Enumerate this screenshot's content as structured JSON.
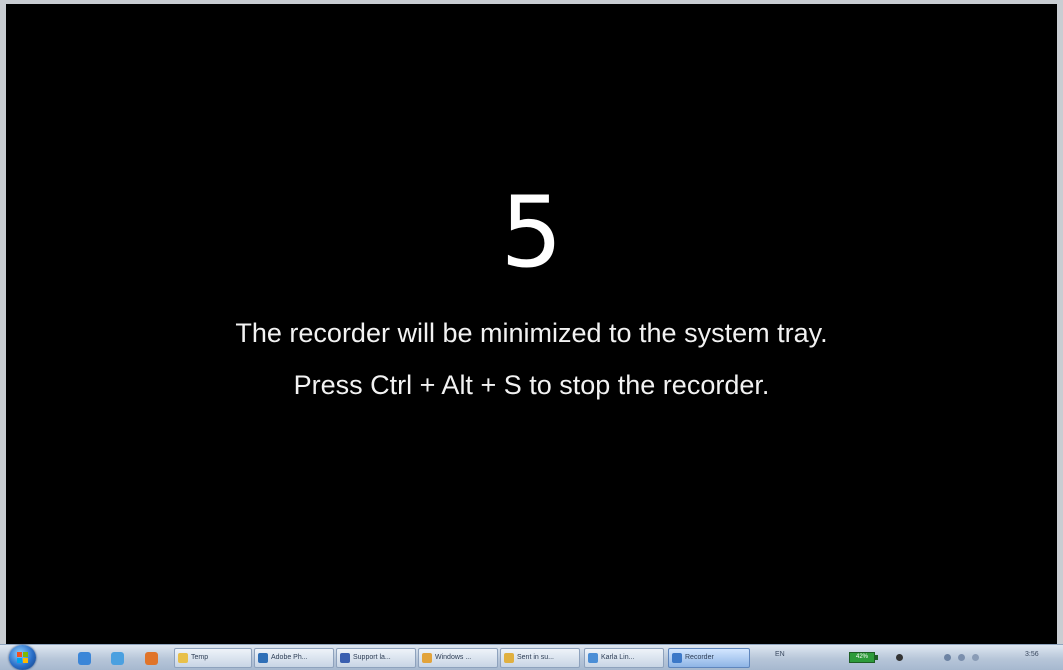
{
  "overlay": {
    "countdown": "5",
    "message_line1": "The recorder will be minimized to the system tray.",
    "message_line2": "Press Ctrl + Alt + S to stop the recorder."
  },
  "taskbar": {
    "quick_launch": [
      {
        "icon": "internet-explorer-icon",
        "color": "#3b86d8"
      },
      {
        "icon": "user-icon",
        "color": "#4aa0e0"
      },
      {
        "icon": "firefox-icon",
        "color": "#e0742a"
      }
    ],
    "tasks": [
      {
        "label": "Temp",
        "icon": "folder-icon",
        "color": "#e8c04a",
        "active": false
      },
      {
        "label": "Adobe Ph...",
        "icon": "photoshop-icon",
        "color": "#2f6fb7",
        "active": false
      },
      {
        "label": "Support la...",
        "icon": "support-icon",
        "color": "#3a5fb0",
        "active": false
      },
      {
        "label": "Windows ...",
        "icon": "windows-icon",
        "color": "#e2a33a",
        "active": false
      },
      {
        "label": "Sent in su...",
        "icon": "mail-icon",
        "color": "#e0b040",
        "active": false
      },
      {
        "label": "Karla Lin...",
        "icon": "browser-icon",
        "color": "#4b8ed6",
        "active": false
      },
      {
        "label": "Recorder",
        "icon": "recorder-icon",
        "color": "#3c78c8",
        "active": true
      }
    ],
    "tray": {
      "language": "EN",
      "battery": "42%",
      "clock": "3:56"
    }
  }
}
